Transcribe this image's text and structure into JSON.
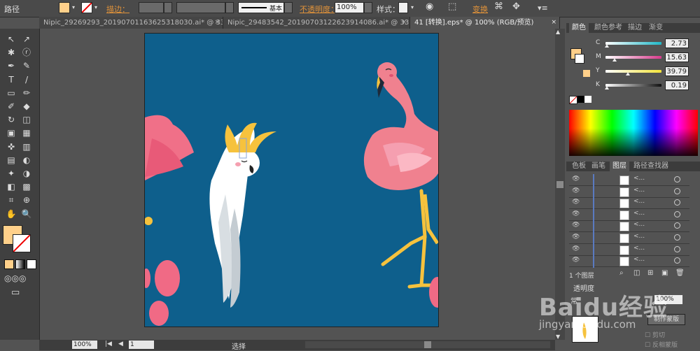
{
  "control_bar": {
    "object_type": "路径",
    "stroke_label": "描边",
    "stroke_sep": "：",
    "stroke_profile": "基本",
    "opacity_label": "不透明度",
    "opacity_sep": "：",
    "opacity_value": "100%",
    "style_label": "样式",
    "style_sep": "：",
    "transform_label": "变换",
    "fill_color": "#ffd08a"
  },
  "tabs": [
    {
      "label": "Nipic_29269293_20190701163625318030.ai* @ 33....",
      "active": false
    },
    {
      "label": "Nipic_29483542_20190703122623914086.ai* @ 33....",
      "active": false
    },
    {
      "label": "41 [转换].eps* @ 100% (RGB/预览)",
      "active": true
    }
  ],
  "tab_close": "×",
  "tools": [
    "↖",
    "↗",
    "✱",
    "ⓡ",
    "✒",
    "✎",
    "T",
    "/",
    "▭",
    "✏",
    "✐",
    "◆",
    "↻",
    "◫",
    "▣",
    "▦",
    "✜",
    "▥",
    "▤",
    "◐",
    "✦",
    "◑",
    "◧",
    "▩",
    "⌗",
    "⊕",
    "✋",
    "🔍"
  ],
  "status": {
    "zoom": "100%",
    "page": "1",
    "mode": "选择"
  },
  "color_panel": {
    "tabs": [
      "颜色",
      "颜色参考",
      "描边",
      "渐变"
    ],
    "channels": [
      {
        "name": "C",
        "value": "2.73",
        "pos": 0.03,
        "grad": "linear-gradient(90deg,#ffffff,#1fb8c8)"
      },
      {
        "name": "M",
        "value": "15.63",
        "pos": 0.16,
        "grad": "linear-gradient(90deg,#ffffff,#d83a8c)"
      },
      {
        "name": "Y",
        "value": "39.79",
        "pos": 0.4,
        "grad": "linear-gradient(90deg,#ffffff,#f2e33a)"
      },
      {
        "name": "K",
        "value": "0.19",
        "pos": 0.02,
        "grad": "linear-gradient(90deg,#ffffff,#111111)"
      }
    ]
  },
  "layers_panel": {
    "tabs": [
      "色板",
      "画笔",
      "图层",
      "路径查找器"
    ],
    "row_name": "<...",
    "row_count": 8,
    "footer": "1 个图层"
  },
  "transparency_panel": {
    "title": "透明度",
    "mode": "常",
    "opacity": "100%",
    "make_mask": "制作蒙版",
    "clip": "剪切",
    "invert": "反相蒙版"
  },
  "watermark": {
    "brand": "Baidu经验",
    "url": "jingyan.baidu.com"
  }
}
